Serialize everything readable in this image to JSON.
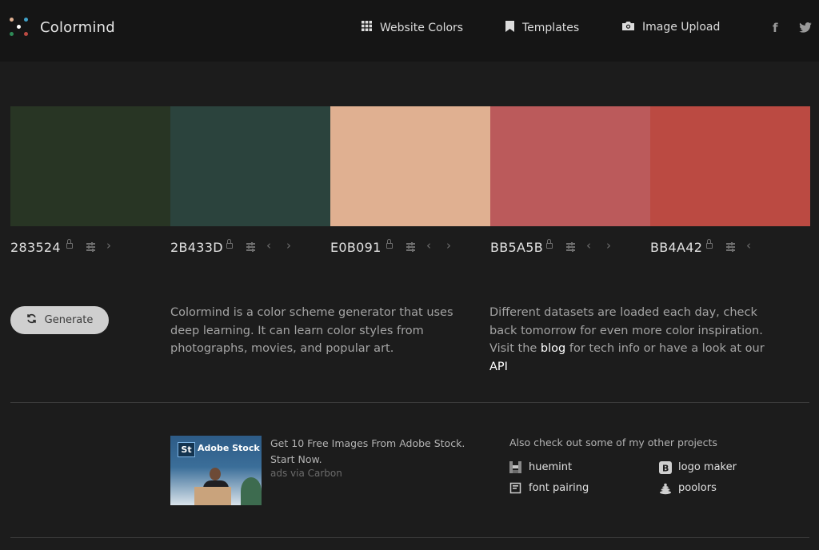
{
  "header": {
    "brand": "Colormind",
    "nav": [
      {
        "label": "Website Colors",
        "icon": "grid-icon"
      },
      {
        "label": "Templates",
        "icon": "bookmark-icon"
      },
      {
        "label": "Image Upload",
        "icon": "camera-icon"
      }
    ],
    "social": [
      {
        "icon": "facebook-icon",
        "glyph": "f"
      },
      {
        "icon": "twitter-icon",
        "glyph": "🐦"
      }
    ]
  },
  "palette": [
    {
      "hex": "283524",
      "color": "#283524",
      "prev": false,
      "next": true
    },
    {
      "hex": "2B433D",
      "color": "#2B433D",
      "prev": true,
      "next": true
    },
    {
      "hex": "E0B091",
      "color": "#E0B091",
      "prev": true,
      "next": true
    },
    {
      "hex": "BB5A5B",
      "color": "#BB5A5B",
      "prev": true,
      "next": true
    },
    {
      "hex": "BB4A42",
      "color": "#BB4A42",
      "prev": true,
      "next": false
    }
  ],
  "generate": {
    "label": "Generate",
    "icon": "refresh-icon"
  },
  "about": {
    "left": "Colormind is a color scheme generator that uses deep learning. It can learn color styles from photographs, movies, and popular art.",
    "right_before": "Different datasets are loaded each day, check back tomorrow for even more color inspiration. Visit the",
    "blog_link": "blog",
    "right_middle": "for tech info or have a look at our",
    "api_link": "API"
  },
  "ad": {
    "image_badge": "St",
    "image_brand": "Adobe Stock",
    "text": "Get 10 Free Images From Adobe Stock. Start Now.",
    "via": "ads via Carbon"
  },
  "projects": {
    "title": "Also check out some of my other projects",
    "items": [
      {
        "label": "huemint",
        "icon": "huemint-icon"
      },
      {
        "label": "logo maker",
        "icon": "logo-maker-icon"
      },
      {
        "label": "font pairing",
        "icon": "font-pairing-icon"
      },
      {
        "label": "poolors",
        "icon": "poolors-icon"
      }
    ]
  },
  "colors": {
    "background": "#1c1c1c",
    "header": "#151515",
    "button": "#cfcfcf",
    "link": "#ffffff"
  }
}
